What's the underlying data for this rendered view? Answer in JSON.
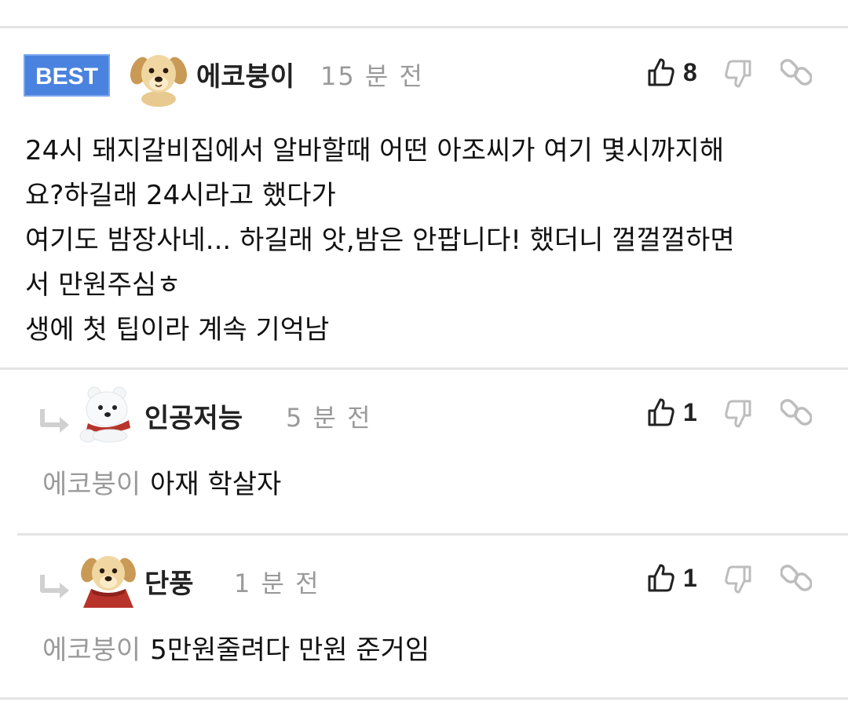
{
  "best_comment": {
    "badge": "BEST",
    "avatar_icon": "puppy-avatar-icon",
    "nickname": "에코붕이",
    "time": "15 분 전",
    "likes": "8",
    "text": "24시 돼지갈비집에서 알바할때 어떤 아조씨가 여기 몇시까지해\n요?하길래 24시라고 했다가\n여기도 밤장사네... 하길래 앗,밤은 안팝니다! 했더니 껄껄껄하면\n서 만원주심ㅎ\n생에 첫 팁이라 계속 기억남"
  },
  "replies": [
    {
      "avatar_icon": "polar-bear-avatar-icon",
      "nickname": "인공저능",
      "time": "5 분 전",
      "likes": "1",
      "mention": "에코붕이",
      "text": "아재 학살자"
    },
    {
      "avatar_icon": "puppy-scarf-avatar-icon",
      "nickname": "단풍",
      "time": "1 분 전",
      "likes": "1",
      "mention": "에코붕이",
      "text": "5만원줄려다 만원 준거임"
    }
  ],
  "colors": {
    "badge_bg": "#4a82df",
    "muted": "#9a9a9a",
    "divider": "#e4e4e4"
  }
}
